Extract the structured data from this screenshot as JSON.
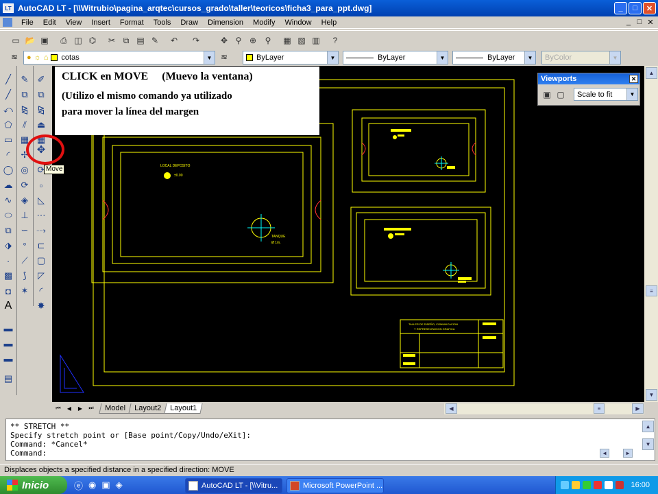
{
  "window": {
    "title": "AutoCAD LT - [\\\\Witrubio\\pagina_arqtec\\cursos_grado\\taller\\teoricos\\ficha3_para_ppt.dwg]",
    "app_icon_text": "LT",
    "minimize": "_",
    "maximize": "□",
    "close": "✕"
  },
  "menu": {
    "items": [
      "File",
      "Edit",
      "View",
      "Insert",
      "Format",
      "Tools",
      "Draw",
      "Dimension",
      "Modify",
      "Window",
      "Help"
    ],
    "mdi_min": "_",
    "mdi_restore": "□",
    "mdi_close": "✕"
  },
  "layers": {
    "layer_name": "cotas",
    "color": "ByLayer",
    "linetype": "ByLayer",
    "lineweight": "ByLayer",
    "plotstyle": "ByColor"
  },
  "callout": {
    "line1a": "CLICK en MOVE",
    "line1b": "(Muevo la ventana)",
    "line2": "(Utilizo el mismo comando ya utilizado",
    "line3": "para mover la línea del margen"
  },
  "tooltip": "Move",
  "viewports": {
    "title": "Viewports",
    "scale": "Scale to fit",
    "close": "✕"
  },
  "drawing": {
    "label_local": "LOCAL DEPOSITO",
    "label_level": "±0.00",
    "label_tanque": "TANQUE",
    "label_tanque_dim": "Ø 1m.",
    "title_block_1": "TALLER DE DISEÑO, COMUNICACION",
    "title_block_2": "Y REPRESENTACION GRAFICA"
  },
  "tabs": [
    "Model",
    "Layout2",
    "Layout1"
  ],
  "active_tab": "Layout1",
  "command_lines": [
    "** STRETCH **",
    "Specify stretch point or [Base point/Copy/Undo/eXit]:",
    "Command: *Cancel*",
    "Command:"
  ],
  "status": "Displaces objects a specified distance in a specified direction:  MOVE",
  "taskbar": {
    "start": "Inicio",
    "items": [
      "AutoCAD LT - [\\\\Vitru...",
      "Microsoft PowerPoint ..."
    ],
    "clock": "16:00"
  },
  "colors": {
    "drawing_lines": "#ffff00",
    "accent_cyan": "#00ffff",
    "title_blue": "#0a5fd8",
    "highlight_red": "#e01010"
  }
}
